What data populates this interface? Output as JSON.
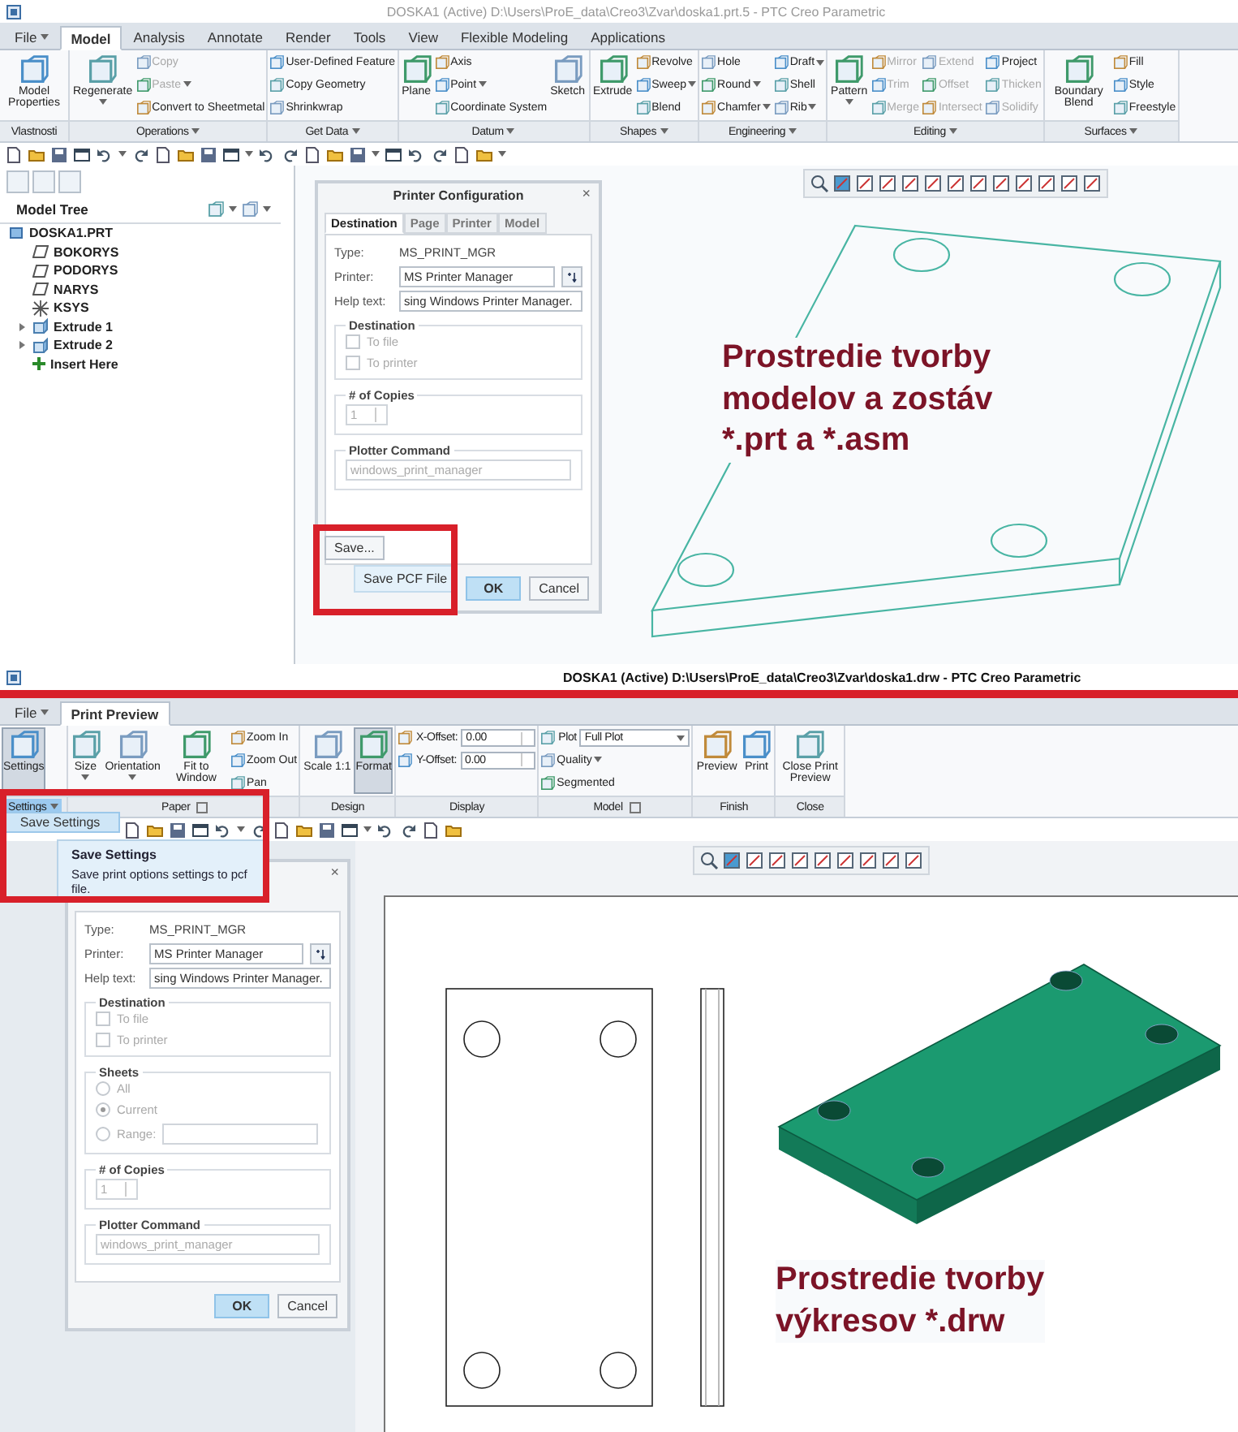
{
  "top_window": {
    "title": "DOSKA1 (Active) D:\\Users\\ProE_data\\Creo3\\Zvar\\doska1.prt.5 - PTC Creo Parametric",
    "tabs": [
      {
        "label": "File",
        "menu": true,
        "selected": false
      },
      {
        "label": "Model",
        "menu": false,
        "selected": true
      },
      {
        "label": "Analysis",
        "menu": false,
        "selected": false
      },
      {
        "label": "Annotate",
        "menu": false,
        "selected": false
      },
      {
        "label": "Render",
        "menu": false,
        "selected": false
      },
      {
        "label": "Tools",
        "menu": false,
        "selected": false
      },
      {
        "label": "View",
        "menu": false,
        "selected": false
      },
      {
        "label": "Flexible Modeling",
        "menu": false,
        "selected": false
      },
      {
        "label": "Applications",
        "menu": false,
        "selected": false
      }
    ],
    "ribbon": {
      "groups": [
        {
          "label": "Vlastnosti",
          "menu": false,
          "launcher": false,
          "open": false,
          "items": [
            {
              "kind": "large",
              "label": "Model Properties",
              "menu": false,
              "disabled": false
            }
          ]
        },
        {
          "label": "Operations",
          "menu": true,
          "launcher": false,
          "open": false,
          "items": [
            {
              "kind": "large",
              "label": "Regenerate",
              "menu": true,
              "disabled": false
            },
            {
              "kind": "small",
              "label": "Copy",
              "menu": false,
              "disabled": true
            },
            {
              "kind": "small",
              "label": "Paste",
              "menu": true,
              "disabled": true
            },
            {
              "kind": "small",
              "label": "Convert to Sheetmetal",
              "menu": false,
              "disabled": false
            }
          ]
        },
        {
          "label": "Get Data",
          "menu": true,
          "launcher": false,
          "open": false,
          "items": [
            {
              "kind": "small",
              "label": "User-Defined Feature",
              "menu": false,
              "disabled": false
            },
            {
              "kind": "small",
              "label": "Copy Geometry",
              "menu": false,
              "disabled": false
            },
            {
              "kind": "small",
              "label": "Shrinkwrap",
              "menu": false,
              "disabled": false
            }
          ]
        },
        {
          "label": "Datum",
          "menu": true,
          "launcher": false,
          "open": false,
          "items": [
            {
              "kind": "large",
              "label": "Plane",
              "menu": false,
              "disabled": false
            },
            {
              "kind": "small",
              "label": "Axis",
              "menu": false,
              "disabled": false
            },
            {
              "kind": "small",
              "label": "Point",
              "menu": true,
              "disabled": false
            },
            {
              "kind": "small",
              "label": "Coordinate System",
              "menu": false,
              "disabled": false
            },
            {
              "kind": "large",
              "label": "Sketch",
              "menu": false,
              "disabled": false
            }
          ]
        },
        {
          "label": "Shapes",
          "menu": true,
          "launcher": false,
          "open": false,
          "items": [
            {
              "kind": "large",
              "label": "Extrude",
              "menu": false,
              "disabled": false
            },
            {
              "kind": "small",
              "label": "Revolve",
              "menu": false,
              "disabled": false
            },
            {
              "kind": "small",
              "label": "Sweep",
              "menu": true,
              "disabled": false
            },
            {
              "kind": "small",
              "label": "Blend",
              "menu": false,
              "disabled": false
            }
          ]
        },
        {
          "label": "Engineering",
          "menu": true,
          "launcher": false,
          "open": false,
          "items": [
            {
              "kind": "small",
              "label": "Hole",
              "menu": false,
              "disabled": false
            },
            {
              "kind": "small",
              "label": "Round",
              "menu": true,
              "disabled": false
            },
            {
              "kind": "small",
              "label": "Chamfer",
              "menu": true,
              "disabled": false
            },
            {
              "kind": "small",
              "label": "Draft",
              "menu": true,
              "disabled": false
            },
            {
              "kind": "small",
              "label": "Shell",
              "menu": false,
              "disabled": false
            },
            {
              "kind": "small",
              "label": "Rib",
              "menu": true,
              "disabled": false
            }
          ]
        },
        {
          "label": "Editing",
          "menu": true,
          "launcher": false,
          "open": false,
          "items": [
            {
              "kind": "large",
              "label": "Pattern",
              "menu": true,
              "disabled": false
            },
            {
              "kind": "small",
              "label": "Mirror",
              "menu": false,
              "disabled": true
            },
            {
              "kind": "small",
              "label": "Trim",
              "menu": false,
              "disabled": true
            },
            {
              "kind": "small",
              "label": "Merge",
              "menu": false,
              "disabled": true
            },
            {
              "kind": "small",
              "label": "Extend",
              "menu": false,
              "disabled": true
            },
            {
              "kind": "small",
              "label": "Offset",
              "menu": false,
              "disabled": true
            },
            {
              "kind": "small",
              "label": "Intersect",
              "menu": false,
              "disabled": true
            },
            {
              "kind": "small",
              "label": "Project",
              "menu": false,
              "disabled": false
            },
            {
              "kind": "small",
              "label": "Thicken",
              "menu": false,
              "disabled": true
            },
            {
              "kind": "small",
              "label": "Solidify",
              "menu": false,
              "disabled": true
            }
          ]
        },
        {
          "label": "Surfaces",
          "menu": true,
          "launcher": false,
          "open": false,
          "items": [
            {
              "kind": "large",
              "label": "Boundary Blend",
              "menu": false,
              "disabled": false
            },
            {
              "kind": "small",
              "label": "Fill",
              "menu": false,
              "disabled": false
            },
            {
              "kind": "small",
              "label": "Style",
              "menu": false,
              "disabled": false
            },
            {
              "kind": "small",
              "label": "Freestyle",
              "menu": false,
              "disabled": false
            }
          ]
        }
      ]
    },
    "model_tree": {
      "title": "Model Tree",
      "items": [
        {
          "label": "DOSKA1.PRT",
          "kind": "part",
          "children": [
            {
              "label": "BOKORYS",
              "kind": "plane"
            },
            {
              "label": "PODORYS",
              "kind": "plane"
            },
            {
              "label": "NARYS",
              "kind": "plane"
            },
            {
              "label": "KSYS",
              "kind": "csys"
            },
            {
              "label": "Extrude 1",
              "kind": "feature",
              "expanded": false
            },
            {
              "label": "Extrude 2",
              "kind": "feature",
              "expanded": false
            },
            {
              "label": "Insert Here",
              "kind": "insert"
            }
          ]
        }
      ]
    },
    "dialog": {
      "title": "Printer Configuration",
      "close": "×",
      "tabs": [
        {
          "label": "Destination",
          "selected": true
        },
        {
          "label": "Page",
          "selected": false
        },
        {
          "label": "Printer",
          "selected": false
        },
        {
          "label": "Model",
          "selected": false
        }
      ],
      "fields": [
        {
          "kind": "text",
          "label": "Type:",
          "value": "MS_PRINT_MGR"
        },
        {
          "kind": "picker",
          "label": "Printer:",
          "value": "MS Printer Manager"
        },
        {
          "kind": "input",
          "label": "Help text:",
          "value": "sing Windows Printer Manager."
        }
      ],
      "sections": [
        {
          "kind": "checkboxes",
          "title": "Destination",
          "options": [
            {
              "label": "To file",
              "checked": false,
              "disabled": true
            },
            {
              "label": "To printer",
              "checked": false,
              "disabled": true
            }
          ]
        },
        {
          "kind": "spinner",
          "title": "# of Copies",
          "value": "1",
          "disabled": true
        },
        {
          "kind": "input",
          "title": "Plotter Command",
          "value": "windows_print_manager",
          "disabled": true
        }
      ],
      "save_menu": {
        "button": "Save...",
        "items": [
          "Save PCF File"
        ]
      },
      "buttons": [
        {
          "label": "OK",
          "kind": "primary"
        },
        {
          "label": "Cancel",
          "kind": "normal"
        }
      ]
    },
    "caption": [
      "Prostredie tvorby",
      "modelov a zostáv",
      "*.prt a *.asm"
    ]
  },
  "bottom_window": {
    "title": "DOSKA1 (Active) D:\\Users\\ProE_data\\Creo3\\Zvar\\doska1.drw - PTC Creo Parametric",
    "tabs": [
      {
        "label": "File",
        "menu": true,
        "selected": false
      },
      {
        "label": "Print Preview",
        "menu": false,
        "selected": true
      }
    ],
    "ribbon": {
      "groups": [
        {
          "label": "Settings",
          "menu": true,
          "launcher": false,
          "open": true,
          "items": [
            {
              "kind": "large",
              "label": "Settings",
              "menu": false,
              "disabled": false,
              "pressed": true
            }
          ]
        },
        {
          "label": "Paper",
          "menu": false,
          "launcher": true,
          "open": false,
          "items": [
            {
              "kind": "large",
              "label": "Size",
              "menu": true,
              "disabled": false,
              "pressed": false
            },
            {
              "kind": "large",
              "label": "Orientation",
              "menu": true,
              "disabled": false,
              "pressed": false
            },
            {
              "kind": "large",
              "label": "Fit to Window",
              "menu": false,
              "disabled": false,
              "pressed": false
            },
            {
              "kind": "small",
              "label": "Zoom In",
              "menu": false,
              "disabled": false
            },
            {
              "kind": "small",
              "label": "Zoom Out",
              "menu": false,
              "disabled": false
            },
            {
              "kind": "small",
              "label": "Pan",
              "menu": false,
              "disabled": false
            }
          ]
        },
        {
          "label": "Design",
          "menu": false,
          "launcher": false,
          "open": false,
          "items": [
            {
              "kind": "large",
              "label": "Scale 1:1",
              "menu": false,
              "disabled": false,
              "pressed": false
            },
            {
              "kind": "large",
              "label": "Format",
              "menu": false,
              "disabled": false,
              "pressed": true
            }
          ]
        },
        {
          "label": "Display",
          "menu": false,
          "launcher": false,
          "open": false,
          "items": [
            {
              "kind": "field",
              "label": "X-Offset:",
              "value": "0.00",
              "disabled": false
            },
            {
              "kind": "field",
              "label": "Y-Offset:",
              "value": "0.00",
              "disabled": false
            }
          ]
        },
        {
          "label": "Model",
          "menu": false,
          "launcher": true,
          "open": false,
          "items": [
            {
              "kind": "select",
              "label": "Plot",
              "value": "Full Plot",
              "disabled": false
            },
            {
              "kind": "small",
              "label": "Quality",
              "menu": true,
              "disabled": false
            },
            {
              "kind": "small",
              "label": "Segmented",
              "menu": false,
              "disabled": false
            }
          ]
        },
        {
          "label": "Finish",
          "menu": false,
          "launcher": false,
          "open": false,
          "items": [
            {
              "kind": "large",
              "label": "Preview",
              "menu": false,
              "disabled": false,
              "pressed": false
            },
            {
              "kind": "large",
              "label": "Print",
              "menu": false,
              "disabled": false,
              "pressed": false
            }
          ]
        },
        {
          "label": "Close",
          "menu": false,
          "launcher": false,
          "open": false,
          "items": [
            {
              "kind": "large",
              "label": "Close Print Preview",
              "menu": false,
              "disabled": false,
              "pressed": false
            }
          ]
        }
      ]
    },
    "settings_menu": {
      "items": [
        {
          "label": "Save Settings",
          "selected": true
        }
      ]
    },
    "tooltip": {
      "title": "Save Settings",
      "text": "Save print options settings to pcf file."
    },
    "dialog": {
      "close": "×",
      "fields": [
        {
          "kind": "text",
          "label": "Type:",
          "value": "MS_PRINT_MGR"
        },
        {
          "kind": "picker",
          "label": "Printer:",
          "value": "MS Printer Manager"
        },
        {
          "kind": "input",
          "label": "Help text:",
          "value": "sing Windows Printer Manager."
        }
      ],
      "sections": [
        {
          "kind": "checkboxes",
          "title": "Destination",
          "options": [
            {
              "label": "To file",
              "checked": false,
              "disabled": true
            },
            {
              "label": "To printer",
              "checked": false,
              "disabled": true
            }
          ]
        },
        {
          "kind": "radios",
          "title": "Sheets",
          "options": [
            {
              "label": "All",
              "kind": "plain",
              "selected": false
            },
            {
              "label": "Current",
              "kind": "plain",
              "selected": true
            },
            {
              "label": "Range:",
              "kind": "field",
              "selected": false
            }
          ]
        },
        {
          "kind": "spinner",
          "title": "# of Copies",
          "value": "1",
          "disabled": true
        },
        {
          "kind": "input",
          "title": "Plotter Command",
          "value": "windows_print_manager",
          "disabled": true
        }
      ],
      "buttons": [
        {
          "label": "OK",
          "kind": "primary"
        },
        {
          "label": "Cancel",
          "kind": "normal"
        }
      ]
    },
    "caption": [
      "Prostredie tvorby",
      "výkresov *.drw"
    ]
  }
}
